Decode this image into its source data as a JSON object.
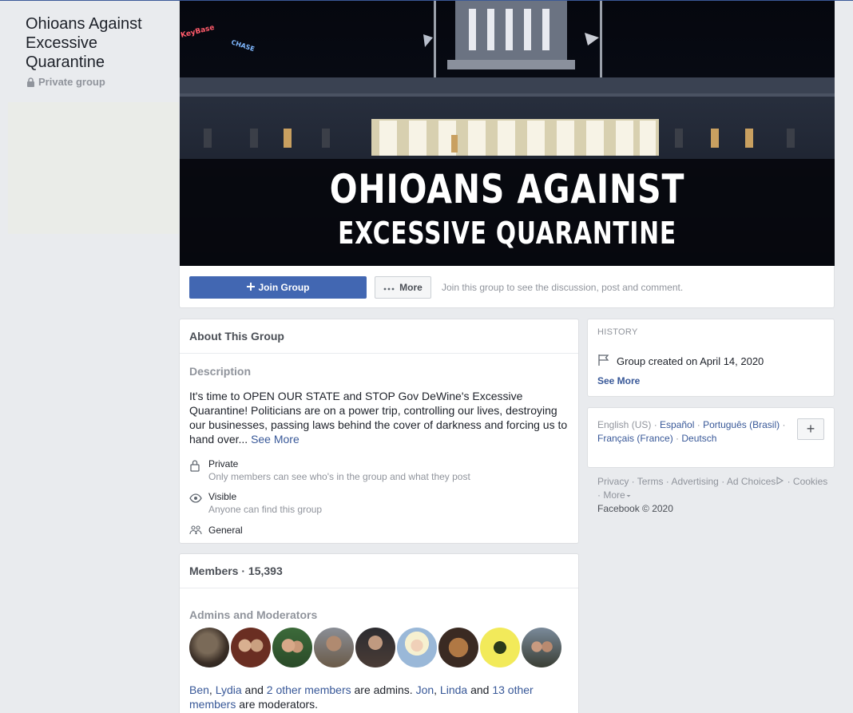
{
  "group": {
    "title": "Ohioans Against Excessive Quarantine",
    "privacy": "Private group"
  },
  "cover": {
    "line1": "OHIOANS AGAINST",
    "line2": "EXCESSIVE QUARANTINE",
    "sign1": "KeyBase",
    "sign2": "CHASE"
  },
  "actions": {
    "join_label": "Join Group",
    "more_label": "More",
    "hint": "Join this group to see the discussion, post and comment."
  },
  "about": {
    "title": "About This Group",
    "description_heading": "Description",
    "description": "It's time to OPEN OUR STATE and STOP Gov DeWine's Excessive Quarantine! Politicians are on a power trip, controlling our lives, destroying our businesses, passing laws behind the cover of darkness and forcing us to hand over...",
    "see_more": "See More",
    "private_title": "Private",
    "private_sub": "Only members can see who's in the group and what they post",
    "visible_title": "Visible",
    "visible_sub": "Anyone can find this group",
    "general": "General"
  },
  "members": {
    "title": "Members · 15,393",
    "admins_heading": "Admins and Moderators",
    "admin1": "Ben",
    "admin2": "Lydia",
    "and1": "and",
    "admins_others": "2 other members",
    "are_admins": "are admins.",
    "mod1": "Jon",
    "mod2": "Linda",
    "and2": "and",
    "mods_others": "13 other members",
    "are_mods": "are moderators."
  },
  "history": {
    "label": "HISTORY",
    "created": "Group created on April 14, 2020",
    "see_more": "See More"
  },
  "languages": {
    "current": "English (US)",
    "items": [
      "Español",
      "Português (Brasil)",
      "Français (France)",
      "Deutsch"
    ],
    "plus": "+"
  },
  "footer": {
    "links": [
      "Privacy",
      "Terms",
      "Advertising",
      "Ad Choices",
      "Cookies",
      "More"
    ],
    "copyright": "Facebook © 2020"
  },
  "colors": {
    "brand": "#4267b2",
    "link": "#385898",
    "background": "#e9ebee"
  }
}
